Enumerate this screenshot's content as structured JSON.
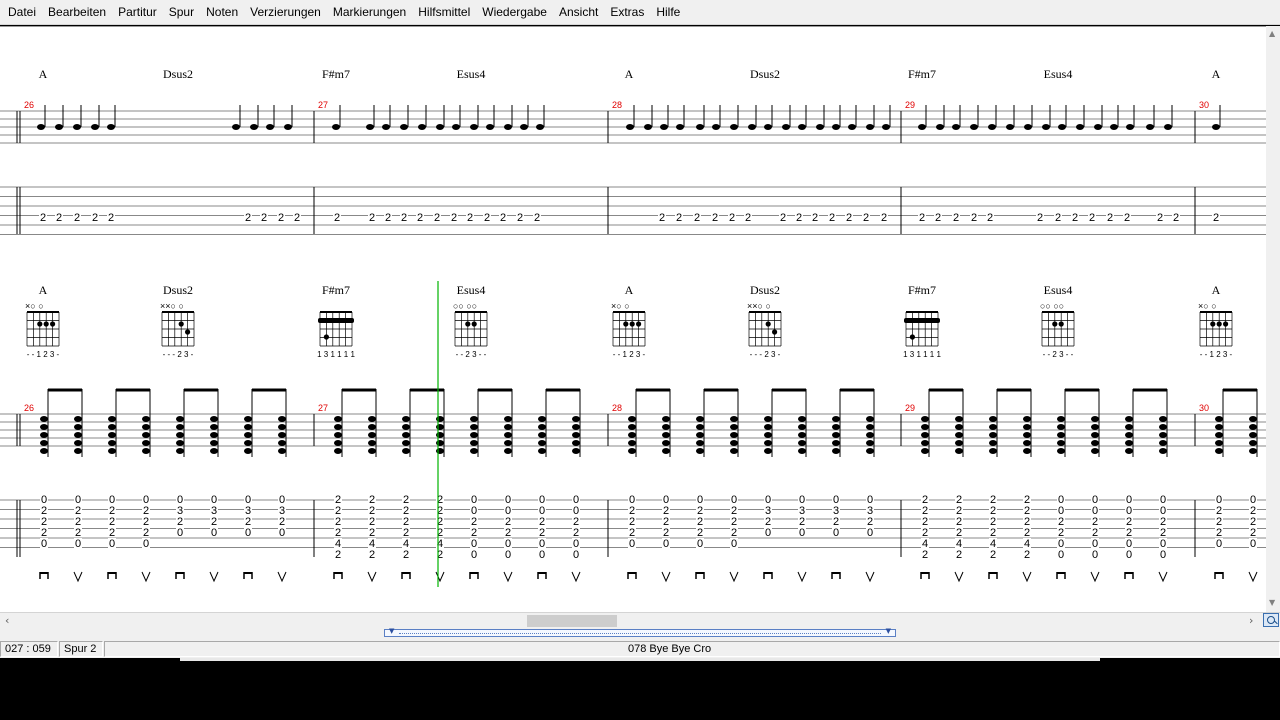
{
  "menu": [
    "Datei",
    "Bearbeiten",
    "Partitur",
    "Spur",
    "Noten",
    "Verzierungen",
    "Markierungen",
    "Hilfsmittel",
    "Wiedergabe",
    "Ansicht",
    "Extras",
    "Hilfe"
  ],
  "status": {
    "position": "027 : 059",
    "track": "Spur 2",
    "song": "078  Bye Bye   Cro"
  },
  "colors": {
    "measure_number": "#e00000",
    "cursor": "#00b400",
    "background": "#ffffff"
  },
  "icons": {
    "zoom": "magnifier-icon",
    "scroll_left": "arrow-left-icon",
    "scroll_right": "arrow-right-icon"
  },
  "score": {
    "system1": {
      "measures": [
        {
          "number": "26",
          "chords": [
            "A",
            "Dsus2"
          ]
        },
        {
          "number": "27",
          "chords": [
            "F#m7",
            "Esus4"
          ]
        },
        {
          "number": "28",
          "chords": [
            "A",
            "Dsus2"
          ]
        },
        {
          "number": "29",
          "chords": [
            "F#m7",
            "Esus4"
          ]
        },
        {
          "number": "30",
          "chords": [
            "A"
          ]
        }
      ],
      "tab": [
        {
          "string": 2,
          "frets": [
            "2",
            "2",
            "2",
            "2",
            "2",
            "2",
            "2",
            "2",
            "2"
          ]
        }
      ]
    },
    "system2": {
      "measures": [
        {
          "number": "26",
          "chords": [
            "A",
            "Dsus2"
          ]
        },
        {
          "number": "27",
          "chords": [
            "F#m7",
            "Esus4"
          ]
        },
        {
          "number": "28",
          "chords": [
            "A",
            "Dsus2"
          ]
        },
        {
          "number": "29",
          "chords": [
            "F#m7",
            "Esus4"
          ]
        },
        {
          "number": "30",
          "chords": [
            "A"
          ]
        }
      ],
      "chord_fingerings": {
        "A": "- - 1 2 3 -",
        "Dsus2": "- - - 2 3 -",
        "F#m7": "1 3 1 1 1 1",
        "Esus4": "- - 2 3 - -"
      },
      "chord_open_marks": {
        "A": "×○    ○",
        "Dsus2": "××○    ○",
        "F#m7": "",
        "Esus4": "○○   ○○"
      },
      "chord_voicings": {
        "A": [
          "0",
          "2",
          "2",
          "2",
          "0",
          ""
        ],
        "Dsus2": [
          "0",
          "3",
          "2",
          "0",
          "",
          ""
        ],
        "F#m7": [
          "2",
          "2",
          "2",
          "2",
          "4",
          "2"
        ],
        "Esus4": [
          "0",
          "0",
          "2",
          "2",
          "0",
          "0"
        ]
      },
      "strokes": [
        "down",
        "up",
        "down",
        "up",
        "down",
        "up",
        "down",
        "up"
      ]
    }
  }
}
